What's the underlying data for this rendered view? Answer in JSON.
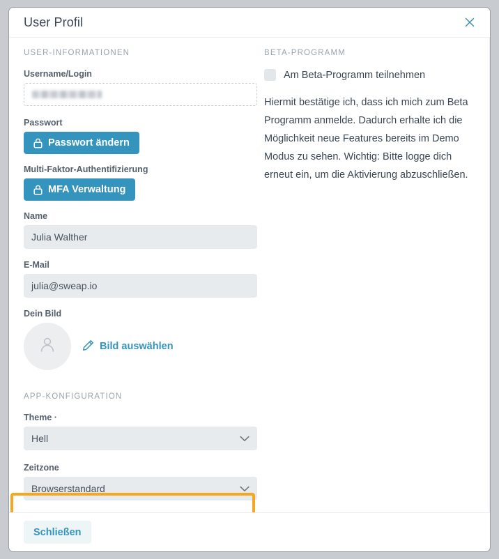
{
  "dialog": {
    "title": "User Profil",
    "close_label": "×"
  },
  "left": {
    "section_title": "USER-INFORMATIONEN",
    "username": {
      "label": "Username/Login",
      "value": "",
      "redacted": true
    },
    "password": {
      "label": "Passwort",
      "button_label": "Passwort ändern"
    },
    "mfa": {
      "label": "Multi-Faktor-Authentifizierung",
      "button_label": "MFA Verwaltung"
    },
    "name": {
      "label": "Name",
      "value": "Julia Walther"
    },
    "email": {
      "label": "E-Mail",
      "value": "julia@sweap.io"
    },
    "picture": {
      "label": "Dein Bild",
      "choose_label": "Bild auswählen"
    },
    "app_section_title": "APP-KONFIGURATION",
    "theme": {
      "label": "Theme ·",
      "value": "Hell"
    },
    "timezone": {
      "label": "Zeitzone",
      "value": "Browserstandard",
      "highlight_color": "#f5a623"
    }
  },
  "right": {
    "section_title": "BETA-PROGRAMM",
    "checkbox_label": "Am Beta-Programm teilnehmen",
    "checked": false,
    "description": "Hiermit bestätige ich, dass ich mich zum Beta Programm anmelde. Dadurch erhalte ich die Möglichkeit neue Features bereits im Demo Modus zu sehen. Wichtig: Bitte logge dich erneut ein, um die Aktivierung abzuschließen."
  },
  "footer": {
    "close_button_label": "Schließen"
  },
  "theme_colors": {
    "accent_blue": "#3494bd",
    "highlight_orange": "#f5a623",
    "input_gray": "#e8ebee",
    "text_dark": "#3b4654"
  }
}
